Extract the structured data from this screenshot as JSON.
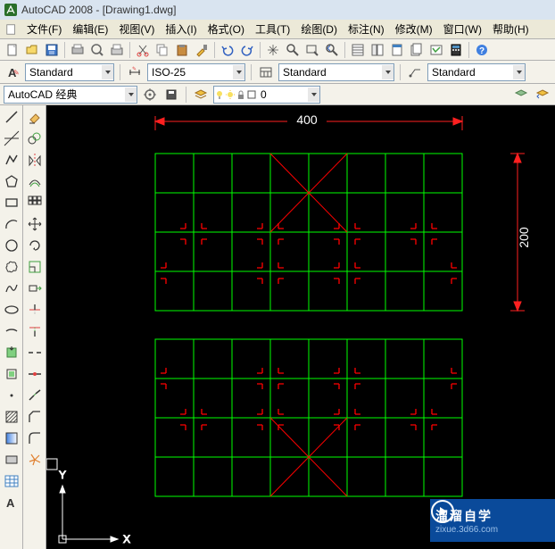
{
  "title": "AutoCAD 2008 - [Drawing1.dwg]",
  "menu": {
    "file": "文件(F)",
    "edit": "编辑(E)",
    "view": "视图(V)",
    "insert": "插入(I)",
    "format": "格式(O)",
    "tools": "工具(T)",
    "draw": "绘图(D)",
    "dimension": "标注(N)",
    "modify": "修改(M)",
    "window": "窗口(W)",
    "help": "帮助(H)"
  },
  "styles": {
    "text_style": "Standard",
    "dim_style": "ISO-25",
    "table_style": "Standard",
    "mleader_style": "Standard"
  },
  "workspace_name": "AutoCAD 经典",
  "layer_current": "0",
  "drawing": {
    "dim_h": "400",
    "dim_v": "200",
    "axis_x": "X",
    "axis_y": "Y"
  },
  "watermark": {
    "text": "溜溜自学",
    "sub": "zixue.3d66.com"
  }
}
